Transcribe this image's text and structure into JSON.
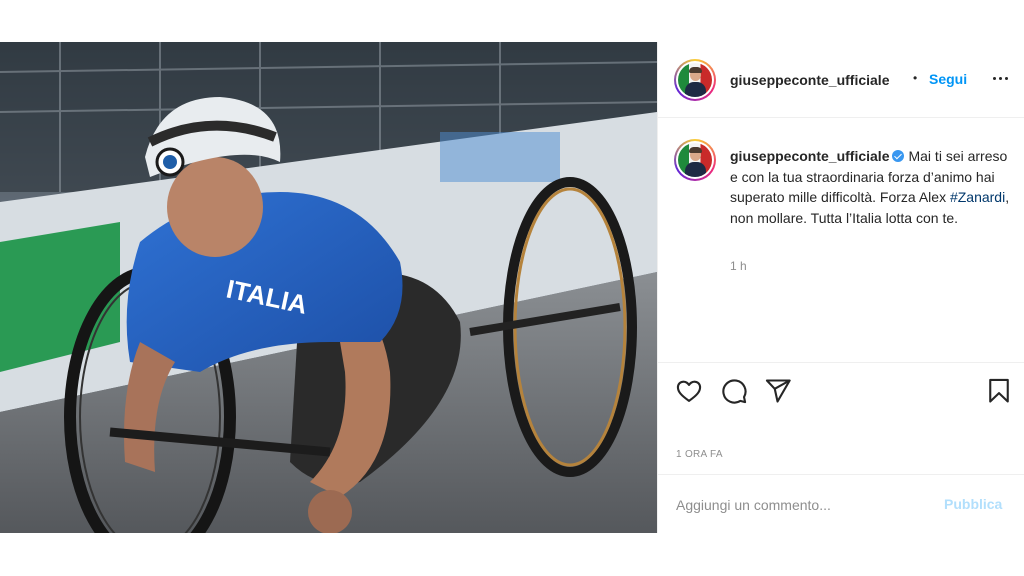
{
  "post": {
    "image_alt": "",
    "author": {
      "username": "giuseppeconte_ufficiale",
      "verified": true
    },
    "header": {
      "separator": "•",
      "follow_label": "Segui",
      "more_icon": "more-horizontal-icon"
    },
    "caption": {
      "username": "giuseppeconte_ufficiale",
      "text_before_tag": "Mai ti sei arreso e con la tua straordinaria forza d’animo hai superato mille difficoltà. Forza Alex ",
      "hashtag": "#Zanardi",
      "text_after_tag": ", non mollare. Tutta l’Italia lotta con te.",
      "time": "1 h"
    },
    "actions": {
      "like_icon": "heart-icon",
      "comment_icon": "comment-icon",
      "share_icon": "paper-plane-icon",
      "save_icon": "bookmark-icon"
    },
    "time_ago": "1 ORA FA",
    "comment_box": {
      "placeholder": "Aggiungi un commento...",
      "publish_label": "Pubblica"
    }
  },
  "colors": {
    "accent": "#0095f6",
    "publish_disabled": "#b2dffc",
    "hashtag": "#00376b",
    "verified": "#3897f0",
    "secondary_text": "#8e8e8e"
  }
}
